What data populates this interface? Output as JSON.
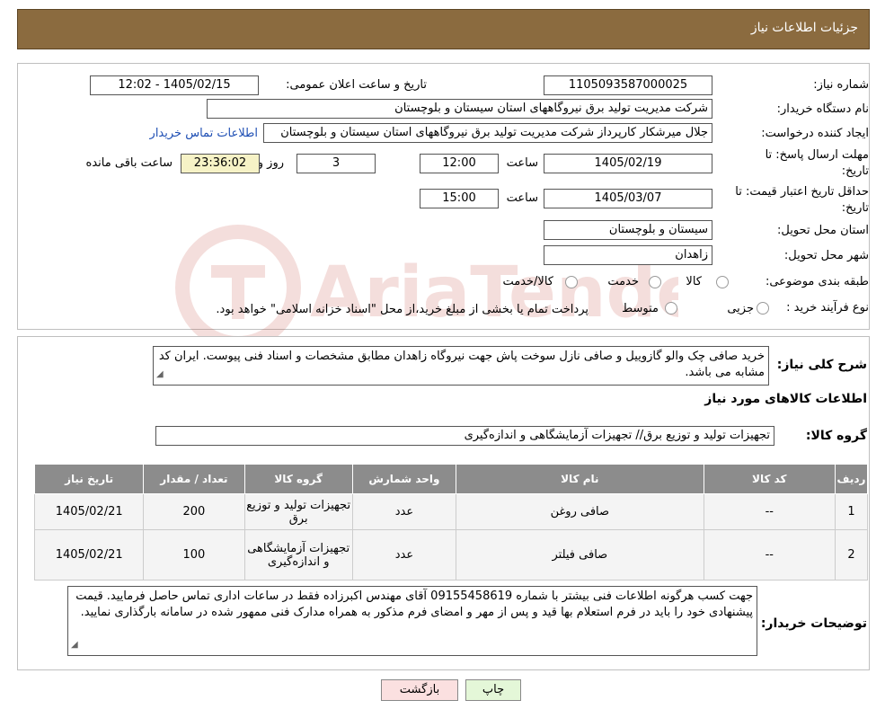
{
  "header": {
    "title": "جزئیات اطلاعات نیاز"
  },
  "form": {
    "need_number_label": "شماره نیاز:",
    "need_number": "1105093587000025",
    "announce_label": "تاریخ و ساعت اعلان عمومی:",
    "announce_value": "1405/02/15 - 12:02",
    "buyer_org_label": "نام دستگاه خریدار:",
    "buyer_org": "شرکت مدیریت تولید برق نیروگاههای استان سیستان و بلوچستان",
    "creator_label": "ایجاد کننده درخواست:",
    "creator": "جلال میرشکار کارپرداز شرکت مدیریت تولید برق نیروگاههای استان سیستان و بلوچستان",
    "contact_link": "اطلاعات تماس خریدار",
    "deadline_label_1": "مهلت ارسال پاسخ: تا",
    "deadline_label_2": "تاریخ:",
    "deadline_date": "1405/02/19",
    "time_label": "ساعت",
    "deadline_time": "12:00",
    "days_value": "3",
    "days_label": "روز و",
    "remaining_time": "23:36:02",
    "remaining_label": "ساعت باقی مانده",
    "validity_label_1": "حداقل تاریخ اعتبار قیمت: تا",
    "validity_label_2": "تاریخ:",
    "validity_date": "1405/03/07",
    "validity_time": "15:00",
    "province_label": "استان محل تحویل:",
    "province": "سیستان و بلوچستان",
    "city_label": "شهر محل تحویل:",
    "city": "زاهدان",
    "category_label": "طبقه بندی موضوعی:",
    "category_options": [
      "کالا",
      "خدمت",
      "کالا/خدمت"
    ],
    "process_label": "نوع فرآیند خرید :",
    "process_options": [
      "جزیی",
      "متوسط"
    ],
    "process_note": "پرداخت تمام یا بخشی از مبلغ خرید،از محل \"اسناد خزانه اسلامی\" خواهد بود."
  },
  "summary": {
    "label": "شرح کلی نیاز:",
    "text": "خرید صافی چک والو گازوییل و صافی نازل سوخت پاش جهت نیروگاه زاهدان مطابق مشخصات و اسناد فنی پیوست. ایران کد مشابه می باشد.",
    "items_title": "اطلاعات کالاهای مورد نیاز",
    "group_label": "گروه کالا:",
    "group_value": "تجهیزات تولید و توزیع برق// تجهیزات آزمایشگاهی و اندازه‌گیری"
  },
  "table": {
    "headers": [
      "ردیف",
      "کد کالا",
      "نام کالا",
      "واحد شمارش",
      "گروه کالا",
      "تعداد / مقدار",
      "تاریخ نیاز"
    ],
    "rows": [
      {
        "row": "1",
        "code": "--",
        "name": "صافی روغن",
        "unit": "عدد",
        "group": "تجهیزات تولید و توزیع برق",
        "qty": "200",
        "date": "1405/02/21"
      },
      {
        "row": "2",
        "code": "--",
        "name": "صافی فیلتر",
        "unit": "عدد",
        "group": "تجهیزات آزمایشگاهی و اندازه‌گیری",
        "qty": "100",
        "date": "1405/02/21"
      }
    ]
  },
  "buyer_notes": {
    "label": "توضیحات خریدار:",
    "text": "جهت کسب هرگونه اطلاعات فنی بیشتر با شماره 09155458619 آقای مهندس اکبرزاده فقط در ساعات اداری تماس حاصل فرمایید. قیمت پیشنهادی خود را باید در فرم استعلام بها قید و پس از مهر و امضای فرم مذکور به همراه مدارک فنی ممهور شده در سامانه بارگذاری نمایید."
  },
  "buttons": {
    "print": "چاپ",
    "back": "بازگشت"
  },
  "watermark": {
    "text": "AriaTender.neT",
    "color": "#c0392b"
  }
}
